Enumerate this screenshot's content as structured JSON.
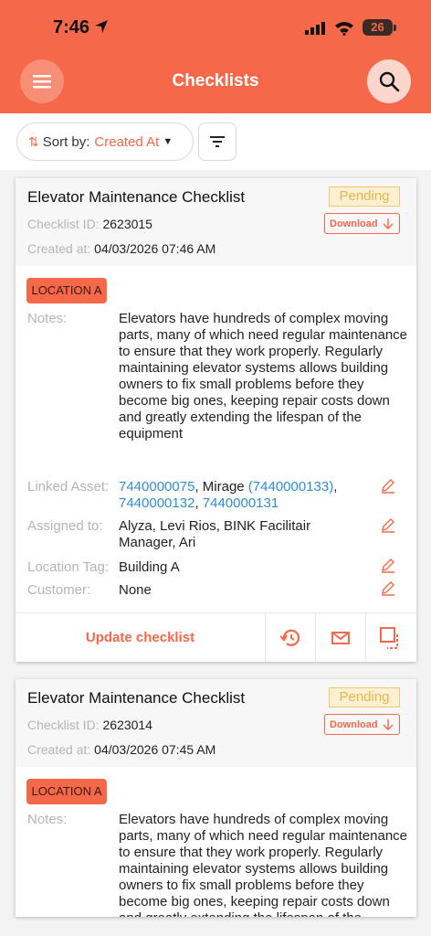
{
  "status_bar": {
    "time": "7:46",
    "battery": "26"
  },
  "header": {
    "title": "Checklists"
  },
  "toolbar": {
    "sort_label": "Sort by:",
    "sort_value": "Created At"
  },
  "colors": {
    "accent": "#f5684a",
    "link": "#2e8ed6",
    "pending_bg": "#fbf0d3",
    "pending_text": "#e8b648"
  },
  "checklists": [
    {
      "title": "Elevator Maintenance Checklist",
      "status": "Pending",
      "download_label": "Download",
      "id_label": "Checklist ID:",
      "id": "2623015",
      "created_label": "Created at:",
      "created": "04/03/2026 07:46 AM",
      "location": "LOCATION A",
      "notes_label": "Notes:",
      "notes": "Elevators have hundreds of complex moving parts, many of which need regular maintenance to ensure that they work properly. Regularly maintaining elevator systems allows building owners to fix small problems before they become big ones, keeping repair costs down and greatly extending the lifespan of the equipment",
      "linked_asset_label": "Linked Asset:",
      "linked_assets": {
        "a1": "7440000075",
        "sep1": ", Mirage ",
        "a2": "(7440000133)",
        "sep2": ",",
        "a3": "7440000132",
        "sep3": ", ",
        "a4": "7440000131"
      },
      "assigned_label": "Assigned to:",
      "assigned": "Alyza, Levi Rios, BINK Facilitair Manager, Ari",
      "location_tag_label": "Location Tag:",
      "location_tag": "Building A",
      "customer_label": "Customer:",
      "customer": "None",
      "update_label": "Update checklist"
    },
    {
      "title": "Elevator Maintenance Checklist",
      "status": "Pending",
      "download_label": "Download",
      "id_label": "Checklist ID:",
      "id": "2623014",
      "created_label": "Created at:",
      "created": "04/03/2026 07:45 AM",
      "location": "LOCATION A",
      "notes_label": "Notes:",
      "notes": "Elevators have hundreds of complex moving parts, many of which need regular maintenance to ensure that they work properly. Regularly maintaining elevator systems allows building owners to fix small problems before they become big ones, keeping repair costs down and greatly extending the lifespan of the equipment"
    }
  ],
  "icons": [
    "location-arrow-icon",
    "signal-icon",
    "wifi-icon",
    "menu-icon",
    "search-icon",
    "sort-arrows-icon",
    "caret-down-icon",
    "filter-icon",
    "download-arrow-icon",
    "pencil-icon",
    "history-icon",
    "mail-icon",
    "expand-icon"
  ]
}
